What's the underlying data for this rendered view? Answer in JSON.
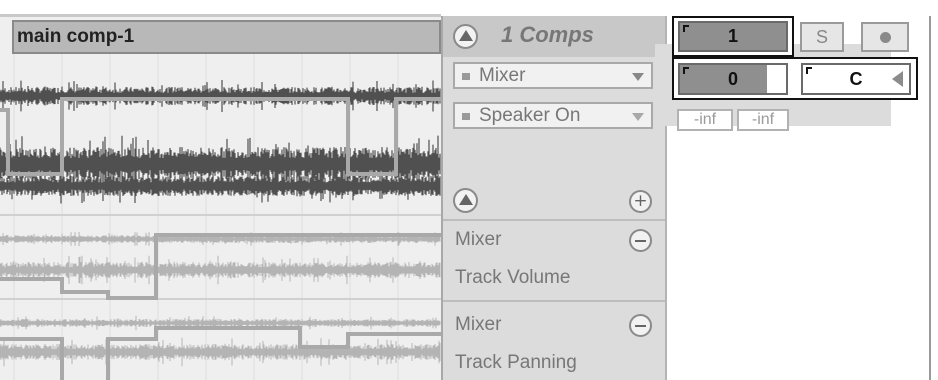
{
  "clip": {
    "name": "main comp-1"
  },
  "panel": {
    "header_title": "1 Comps",
    "device_chooser": "Mixer",
    "control_chooser": "Speaker On",
    "lanes": [
      {
        "device": "Mixer",
        "parameter": "Track Volume"
      },
      {
        "device": "Mixer",
        "parameter": "Track Panning"
      }
    ]
  },
  "mixer": {
    "track_number": "1",
    "volume_value": "0",
    "pan_value": "C",
    "solo_label": "S",
    "peak_left": "-inf",
    "peak_right": "-inf"
  },
  "colors": {
    "waveform": "#505050",
    "waveform_faded": "#b4b4b4",
    "automation_line": "#a9a9a9",
    "track_field": "#8f8f8f"
  },
  "icons": {
    "fold": "triangle-up-icon",
    "add_lane": "plus-icon",
    "remove_lane": "minus-icon",
    "record": "record-icon",
    "pan_arrow": "triangle-left-icon",
    "chooser": "chevron-down-icon"
  }
}
